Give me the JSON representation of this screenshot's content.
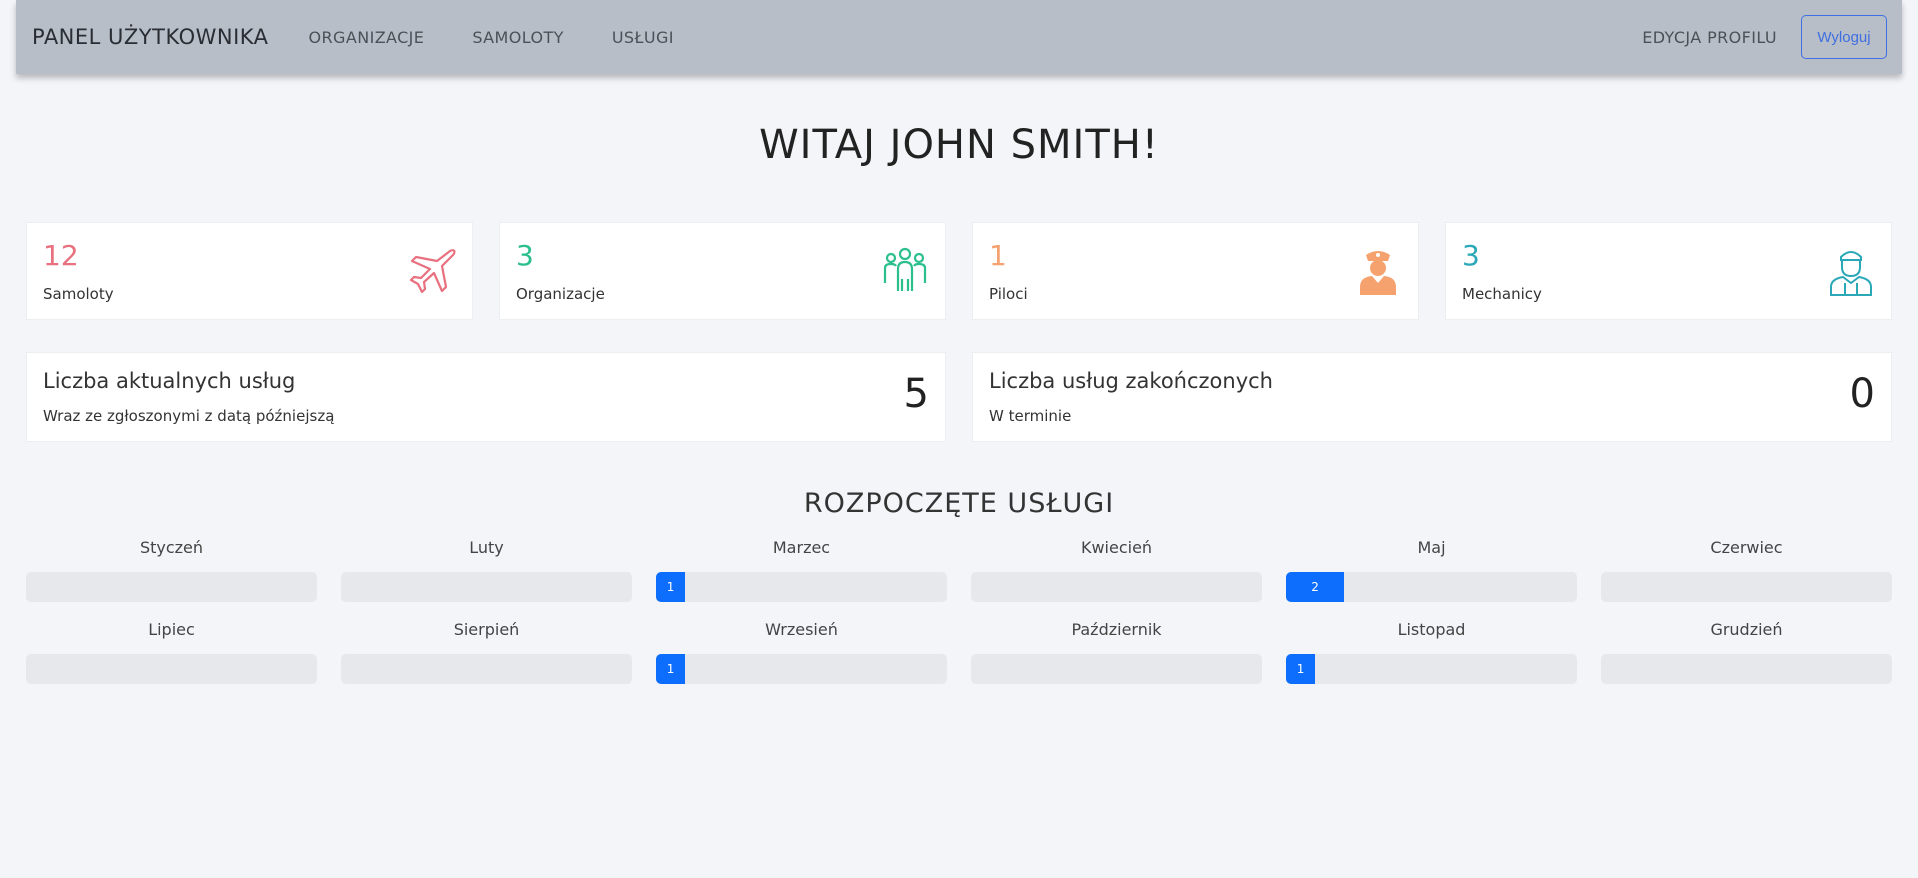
{
  "navbar": {
    "brand": "PANEL UŻYTKOWNIKA",
    "links": [
      "ORGANIZACJE",
      "SAMOLOTY",
      "USŁUGI"
    ],
    "profile": "EDYCJA PROFILU",
    "logout": "Wyloguj"
  },
  "welcome": "WITAJ JOHN SMITH!",
  "stats": [
    {
      "value": "12",
      "label": "Samoloty",
      "color": "#e8707f",
      "icon": "airplane-icon"
    },
    {
      "value": "3",
      "label": "Organizacje",
      "color": "#2bbf8c",
      "icon": "group-icon"
    },
    {
      "value": "1",
      "label": "Piloci",
      "color": "#f5a26e",
      "icon": "pilot-icon"
    },
    {
      "value": "3",
      "label": "Mechanicy",
      "color": "#2ba8b8",
      "icon": "mechanic-icon"
    }
  ],
  "summary": [
    {
      "title": "Liczba aktualnych usług",
      "subtitle": "Wraz ze zgłoszonymi z datą późniejszą",
      "value": "5"
    },
    {
      "title": "Liczba usług zakończonych",
      "subtitle": "W terminie",
      "value": "0"
    }
  ],
  "section_title": "ROZPOCZĘTE USŁUGI",
  "months": [
    {
      "name": "Styczeń",
      "count": "",
      "fraction": 0
    },
    {
      "name": "Luty",
      "count": "",
      "fraction": 0
    },
    {
      "name": "Marzec",
      "count": "1",
      "fraction": 0.1
    },
    {
      "name": "Kwiecień",
      "count": "",
      "fraction": 0
    },
    {
      "name": "Maj",
      "count": "2",
      "fraction": 0.2
    },
    {
      "name": "Czerwiec",
      "count": "",
      "fraction": 0
    },
    {
      "name": "Lipiec",
      "count": "",
      "fraction": 0
    },
    {
      "name": "Sierpień",
      "count": "",
      "fraction": 0
    },
    {
      "name": "Wrzesień",
      "count": "1",
      "fraction": 0.1
    },
    {
      "name": "Październik",
      "count": "",
      "fraction": 0
    },
    {
      "name": "Listopad",
      "count": "1",
      "fraction": 0.1
    },
    {
      "name": "Grudzień",
      "count": "",
      "fraction": 0
    }
  ]
}
